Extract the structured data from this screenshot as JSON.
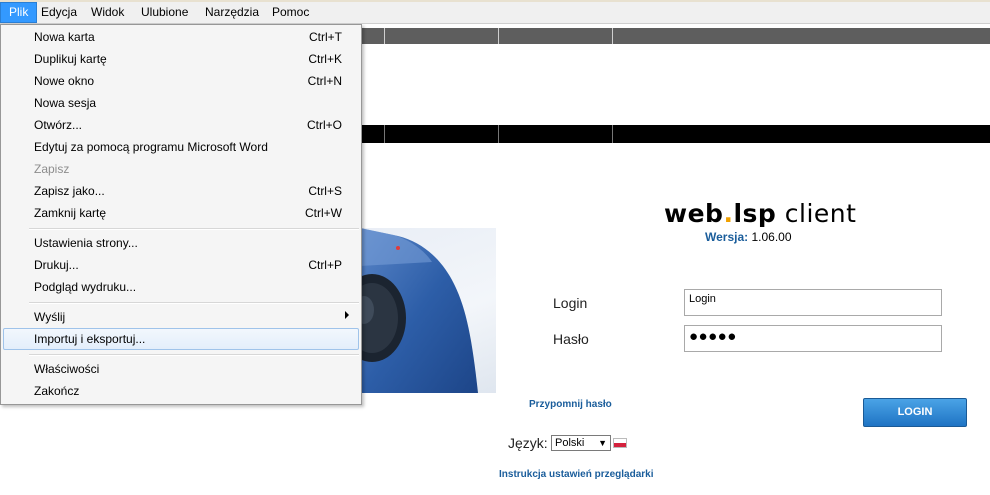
{
  "menubar": {
    "items": [
      {
        "label": "Plik",
        "active": true
      },
      {
        "label": "Edycja",
        "active": false
      },
      {
        "label": "Widok",
        "active": false
      },
      {
        "label": "Ulubione",
        "active": false
      },
      {
        "label": "Narzędzia",
        "active": false
      },
      {
        "label": "Pomoc",
        "active": false
      }
    ]
  },
  "file_menu": {
    "items": [
      {
        "label": "Nowa karta",
        "shortcut": "Ctrl+T"
      },
      {
        "label": "Duplikuj kartę",
        "shortcut": "Ctrl+K"
      },
      {
        "label": "Nowe okno",
        "shortcut": "Ctrl+N"
      },
      {
        "label": "Nowa sesja",
        "shortcut": ""
      },
      {
        "label": "Otwórz...",
        "shortcut": "Ctrl+O"
      },
      {
        "label": "Edytuj za pomocą programu Microsoft Word",
        "shortcut": ""
      },
      {
        "label": "Zapisz",
        "shortcut": "",
        "disabled": true
      },
      {
        "label": "Zapisz jako...",
        "shortcut": "Ctrl+S"
      },
      {
        "label": "Zamknij kartę",
        "shortcut": "Ctrl+W"
      },
      {
        "label": "Ustawienia strony...",
        "shortcut": ""
      },
      {
        "label": "Drukuj...",
        "shortcut": "Ctrl+P"
      },
      {
        "label": "Podgląd wydruku...",
        "shortcut": ""
      },
      {
        "label": "Wyślij",
        "shortcut": "",
        "submenu": true
      },
      {
        "label": "Importuj i eksportuj...",
        "shortcut": "",
        "highlighted": true
      },
      {
        "label": "Właściwości",
        "shortcut": ""
      },
      {
        "label": "Zakończ",
        "shortcut": ""
      }
    ]
  },
  "app": {
    "logo_web": "web",
    "logo_dot": ".",
    "logo_lsp": "lsp",
    "logo_client": "client",
    "version_label": "Wersja:",
    "version_value": "1.06.00"
  },
  "form": {
    "login_label": "Login",
    "password_label": "Hasło",
    "login_value": "Login",
    "password_value": "●●●●●",
    "remind_link": "Przypomnij hasło",
    "login_button": "LOGIN",
    "language_label": "Język:",
    "language_value": "Polski",
    "instructions_link": "Instrukcja ustawień przeglądarki"
  },
  "colors": {
    "menu_active": "#3399ff",
    "link": "#1a5d9b",
    "logo_dot": "#f0a000",
    "button": "#1f74c4"
  }
}
